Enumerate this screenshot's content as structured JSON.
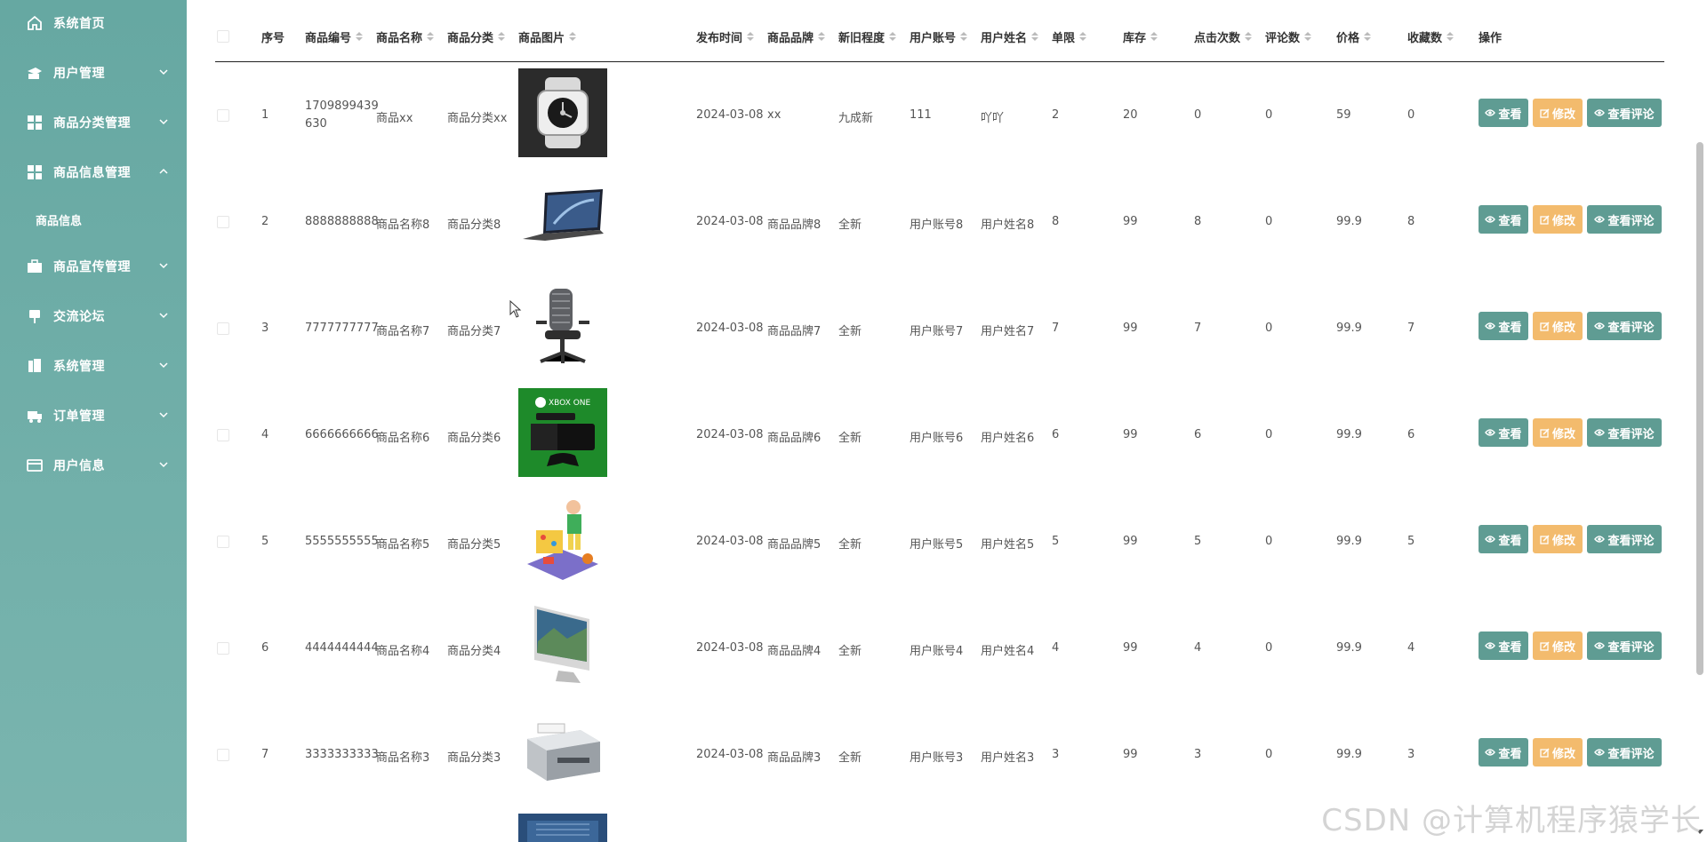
{
  "sidebar": {
    "items": [
      {
        "label": "系统首页",
        "icon": "home-icon"
      },
      {
        "label": "用户管理",
        "icon": "user-group-icon"
      },
      {
        "label": "商品分类管理",
        "icon": "grid-icon"
      },
      {
        "label": "商品信息管理",
        "icon": "grid-icon"
      },
      {
        "label": "商品宣传管理",
        "icon": "briefcase-icon"
      },
      {
        "label": "交流论坛",
        "icon": "message-icon"
      },
      {
        "label": "系统管理",
        "icon": "building-icon"
      },
      {
        "label": "订单管理",
        "icon": "truck-icon"
      },
      {
        "label": "用户信息",
        "icon": "card-icon"
      }
    ],
    "submenu": [
      {
        "label": "商品信息"
      }
    ]
  },
  "table": {
    "headers": [
      "序号",
      "商品编号",
      "商品名称",
      "商品分类",
      "商品图片",
      "发布时间",
      "商品品牌",
      "新旧程度",
      "用户账号",
      "用户姓名",
      "单限",
      "库存",
      "点击次数",
      "评论数",
      "价格",
      "收藏数",
      "操作"
    ],
    "rows": [
      {
        "index": "1",
        "code": "1709899439630",
        "name": "商品xx",
        "category": "商品分类xx",
        "image": "watch",
        "date": "2024-03-08",
        "brand": "xx",
        "condition": "九成新",
        "account": "111",
        "username": "吖吖",
        "limit": "2",
        "stock": "20",
        "clicks": "0",
        "comments": "0",
        "price": "59",
        "favorites": "0"
      },
      {
        "index": "2",
        "code": "8888888888",
        "name": "商品名称8",
        "category": "商品分类8",
        "image": "laptop",
        "date": "2024-03-08",
        "brand": "商品品牌8",
        "condition": "全新",
        "account": "用户账号8",
        "username": "用户姓名8",
        "limit": "8",
        "stock": "99",
        "clicks": "8",
        "comments": "0",
        "price": "99.9",
        "favorites": "8"
      },
      {
        "index": "3",
        "code": "7777777777",
        "name": "商品名称7",
        "category": "商品分类7",
        "image": "chair",
        "date": "2024-03-08",
        "brand": "商品品牌7",
        "condition": "全新",
        "account": "用户账号7",
        "username": "用户姓名7",
        "limit": "7",
        "stock": "99",
        "clicks": "7",
        "comments": "0",
        "price": "99.9",
        "favorites": "7"
      },
      {
        "index": "4",
        "code": "6666666666",
        "name": "商品名称6",
        "category": "商品分类6",
        "image": "xbox",
        "date": "2024-03-08",
        "brand": "商品品牌6",
        "condition": "全新",
        "account": "用户账号6",
        "username": "用户姓名6",
        "limit": "6",
        "stock": "99",
        "clicks": "6",
        "comments": "0",
        "price": "99.9",
        "favorites": "6"
      },
      {
        "index": "5",
        "code": "5555555555",
        "name": "商品名称5",
        "category": "商品分类5",
        "image": "toy",
        "date": "2024-03-08",
        "brand": "商品品牌5",
        "condition": "全新",
        "account": "用户账号5",
        "username": "用户姓名5",
        "limit": "5",
        "stock": "99",
        "clicks": "5",
        "comments": "0",
        "price": "99.9",
        "favorites": "5"
      },
      {
        "index": "6",
        "code": "4444444444",
        "name": "商品名称4",
        "category": "商品分类4",
        "image": "imac",
        "date": "2024-03-08",
        "brand": "商品品牌4",
        "condition": "全新",
        "account": "用户账号4",
        "username": "用户姓名4",
        "limit": "4",
        "stock": "99",
        "clicks": "4",
        "comments": "0",
        "price": "99.9",
        "favorites": "4"
      },
      {
        "index": "7",
        "code": "3333333333",
        "name": "商品名称3",
        "category": "商品分类3",
        "image": "printer",
        "date": "2024-03-08",
        "brand": "商品品牌3",
        "condition": "全新",
        "account": "用户账号3",
        "username": "用户姓名3",
        "limit": "3",
        "stock": "99",
        "clicks": "3",
        "comments": "0",
        "price": "99.9",
        "favorites": "3"
      }
    ],
    "actions": {
      "view": "查看",
      "edit": "修改",
      "comments": "查看评论"
    }
  },
  "watermark": "CSDN @计算机程序猿学长",
  "colors": {
    "sidebar": "#6aaba5",
    "view_button": "#5f9c93",
    "edit_button": "#f3bb6d"
  }
}
